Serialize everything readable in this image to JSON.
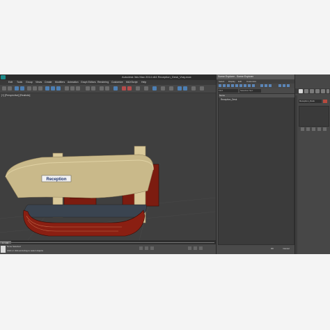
{
  "window": {
    "title": "Autodesk 3ds Max 2014 x64    Reception_Desk_Vray.max"
  },
  "menubar": {
    "items": [
      "Edit",
      "Tools",
      "Group",
      "Views",
      "Create",
      "Modifiers",
      "Animation",
      "Graph Editors",
      "Rendering",
      "Customize",
      "MAXScript",
      "Help"
    ]
  },
  "viewport": {
    "label": "[+] [Perspective] [Realistic]",
    "sign_text": "Reception"
  },
  "timeline": {
    "frame_label": "0 / 100"
  },
  "statusbar": {
    "line1": "None Selected",
    "line2": "Click or click-and-drag to select objects"
  },
  "scene_explorer": {
    "title": "Scene Explorer - Scene Explorer",
    "menu": [
      "Select",
      "Display",
      "Edit",
      "Customize"
    ],
    "find_label": "Find",
    "selection_set": "Selection Set:",
    "column_header": "Name",
    "rows": [
      "Reception_Desk"
    ],
    "ok_label": "OK",
    "cancel_label": "Cancel"
  },
  "command_panel": {
    "name_value": "Reception_Desk"
  },
  "colors": {
    "roof": "#c9b98a",
    "desk_wood": "#8a1f12",
    "desk_top": "#3a4450",
    "column": "#d9c99a",
    "swatch": "#b74a3e"
  },
  "icons": [
    "app-logo-icon",
    "toolbar-icons",
    "explorer-toolbar-icons",
    "command-tab-icons"
  ]
}
